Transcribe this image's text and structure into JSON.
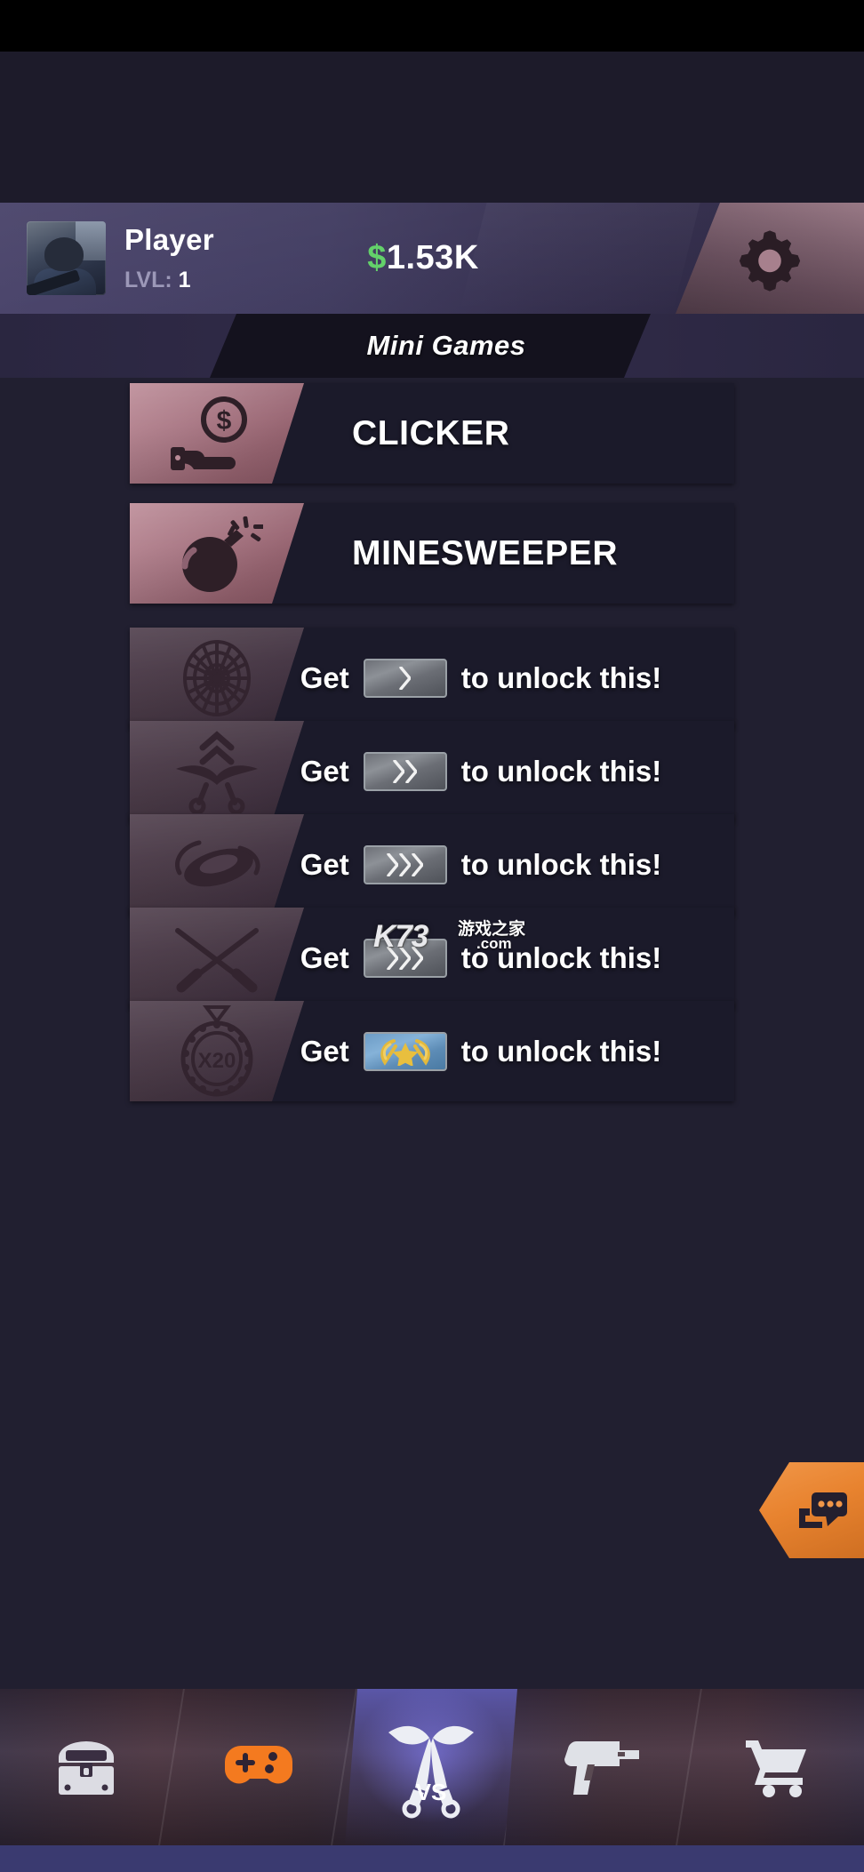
{
  "header": {
    "player_name": "Player",
    "level_label": "LVL:",
    "level_value": "1",
    "currency_symbol": "$",
    "currency_amount": "1.53K",
    "settings_icon": "gear-icon",
    "avatar_icon": "player-avatar"
  },
  "tab": {
    "active_label": "Mini Games"
  },
  "minigames": [
    {
      "id": "clicker",
      "title": "CLICKER",
      "locked": false,
      "icon": "hand-coin-icon"
    },
    {
      "id": "minesweeper",
      "title": "MINESWEEPER",
      "locked": false,
      "icon": "bomb-icon"
    },
    {
      "id": "wheel",
      "title": "",
      "locked": true,
      "icon": "dartboard-wheel-icon",
      "lock_prefix": "Get",
      "lock_suffix": "to unlock this!",
      "rank": {
        "tier": "silver",
        "chevrons": 1,
        "star": false
      }
    },
    {
      "id": "slingshot",
      "title": "",
      "locked": true,
      "icon": "slingshot-icon",
      "lock_prefix": "Get",
      "lock_suffix": "to unlock this!",
      "rank": {
        "tier": "silver",
        "chevrons": 2,
        "star": false
      }
    },
    {
      "id": "disc",
      "title": "",
      "locked": true,
      "icon": "flying-disc-icon",
      "lock_prefix": "Get",
      "lock_suffix": "to unlock this!",
      "rank": {
        "tier": "silver",
        "chevrons": 3,
        "star": false
      }
    },
    {
      "id": "knives",
      "title": "",
      "locked": true,
      "icon": "crossed-knives-icon",
      "lock_prefix": "Get",
      "lock_suffix": "to unlock this!",
      "rank": {
        "tier": "silver",
        "chevrons": 3,
        "star": false
      }
    },
    {
      "id": "medal",
      "title": "",
      "locked": true,
      "icon": "medal-x20-icon",
      "icon_text": "X20",
      "lock_prefix": "Get",
      "lock_suffix": "to unlock this!",
      "rank": {
        "tier": "blue",
        "chevrons": 0,
        "star": true
      }
    }
  ],
  "chat_button": {
    "icon": "chat-bubble-icon"
  },
  "bottom_nav": [
    {
      "id": "cases",
      "icon": "crate-icon",
      "active": false
    },
    {
      "id": "games",
      "icon": "gamepad-icon",
      "active": false
    },
    {
      "id": "versus",
      "icon": "knives-vs-icon",
      "label": "VS",
      "active": true
    },
    {
      "id": "weapons",
      "icon": "pistol-icon",
      "active": false
    },
    {
      "id": "shop",
      "icon": "cart-icon",
      "active": false
    }
  ],
  "watermark": {
    "brand": "K73",
    "chinese": "游戏之家",
    "domain": ".com"
  },
  "colors": {
    "background": "#211f30",
    "row_bg": "#1b1a2a",
    "header_purple": "#413c61",
    "money_green": "#63d16a",
    "accent_orange": "#e8832f",
    "active_nav": "#5b57a8",
    "unlocked_icon": "#a87683",
    "locked_icon": "#473744"
  }
}
